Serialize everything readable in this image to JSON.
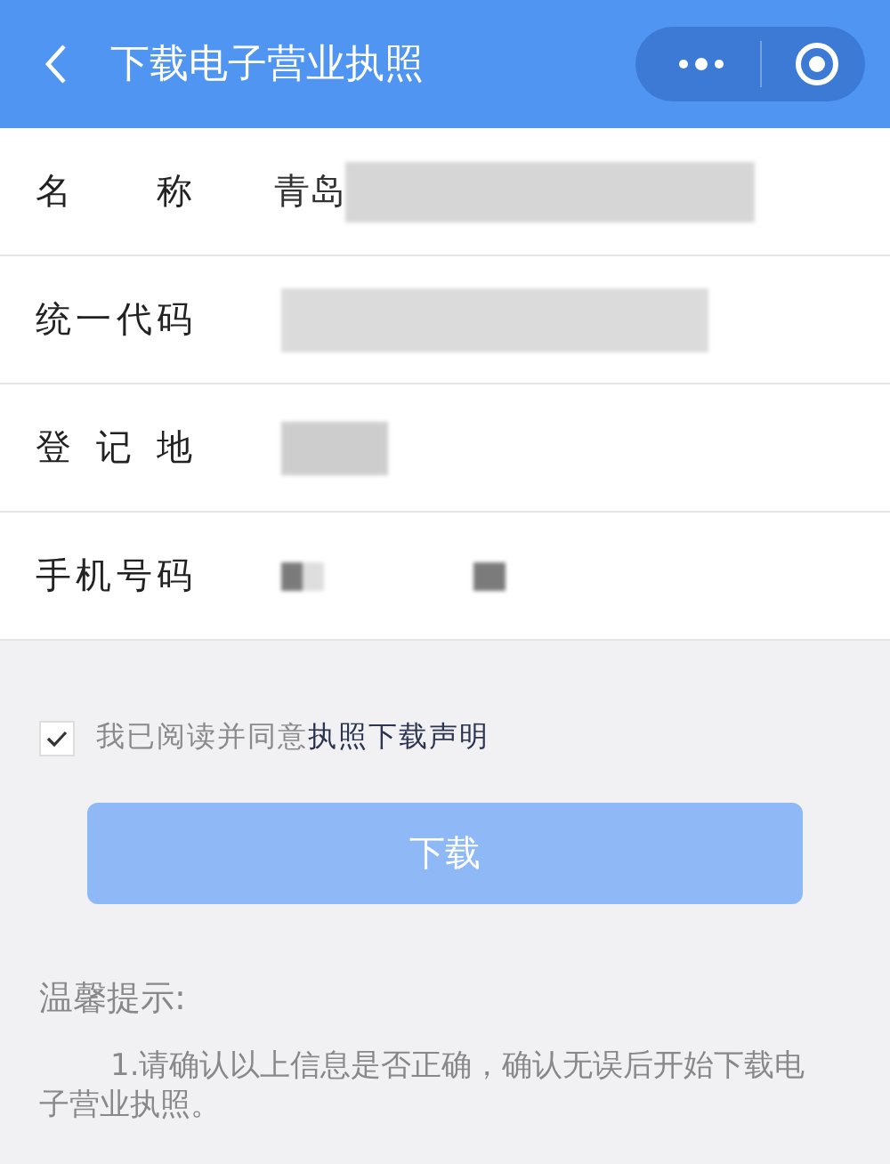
{
  "header": {
    "title": "下载电子营业执照"
  },
  "fields": [
    {
      "label": "名称",
      "value": "青岛",
      "redacted": true
    },
    {
      "label": "统一代码",
      "redacted": true
    },
    {
      "label": "登记地",
      "redacted": true
    },
    {
      "label": "手机号码",
      "redacted": true
    }
  ],
  "agreement": {
    "checked": true,
    "text": "我已阅读并同意",
    "link": "执照下载声明"
  },
  "download_button": {
    "label": "下载",
    "disabled": true
  },
  "tips": {
    "title": "温馨提示:",
    "items": [
      "1.请确认以上信息是否正确，确认无误后开始下载电子营业执照。"
    ]
  }
}
